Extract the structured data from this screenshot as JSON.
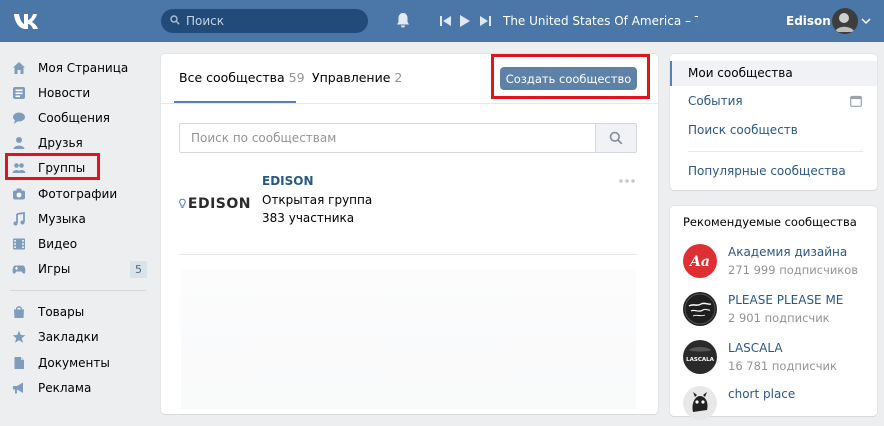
{
  "topbar": {
    "logo": "vk-logo",
    "search_placeholder": "Поиск",
    "track_title": "The United States Of America – The ...",
    "user_name": "Edison"
  },
  "nav": {
    "items": [
      {
        "label": "Моя Страница",
        "icon": "home-icon"
      },
      {
        "label": "Новости",
        "icon": "news-icon"
      },
      {
        "label": "Сообщения",
        "icon": "messages-icon"
      },
      {
        "label": "Друзья",
        "icon": "friends-icon"
      },
      {
        "label": "Группы",
        "icon": "groups-icon"
      },
      {
        "label": "Фотографии",
        "icon": "camera-icon"
      },
      {
        "label": "Музыка",
        "icon": "music-icon"
      },
      {
        "label": "Видео",
        "icon": "video-icon"
      },
      {
        "label": "Игры",
        "icon": "games-icon",
        "badge": "5"
      }
    ],
    "items2": [
      {
        "label": "Товары",
        "icon": "bag-icon"
      },
      {
        "label": "Закладки",
        "icon": "star-icon"
      },
      {
        "label": "Документы",
        "icon": "document-icon"
      },
      {
        "label": "Реклама",
        "icon": "megaphone-icon"
      }
    ]
  },
  "main": {
    "tab_all": "Все сообщества",
    "tab_all_count": "59",
    "tab_manage": "Управление",
    "tab_manage_count": "2",
    "create_label": "Создать сообщество",
    "search_placeholder": "Поиск по сообществам",
    "group": {
      "logo_text": "EDISON",
      "name": "EDISON",
      "type": "Открытая группа",
      "members": "383 участника"
    }
  },
  "right_menu": {
    "items": [
      "Мои сообщества",
      "События",
      "Поиск сообществ",
      "Популярные сообщества"
    ]
  },
  "recommended": {
    "title": "Рекомендуемые сообщества",
    "items": [
      {
        "name": "Академия дизайна",
        "sub": "271 999 подписчиков",
        "avatar_text": "Aa",
        "color": "#e02f33"
      },
      {
        "name": "PLEASE PLEASE ME",
        "sub": "2 901 подписчик",
        "avatar_text": "Please please me",
        "color": "#1e1e1e"
      },
      {
        "name": "LASCALA",
        "sub": "16 781 подписчик",
        "avatar_text": "LASCALA",
        "color": "#2a2a2a"
      },
      {
        "name": "chort place",
        "sub": "",
        "avatar_text": "",
        "color": "#e8e8e8"
      }
    ]
  },
  "colors": {
    "topbar": "#4a76a8",
    "link": "#2a5885",
    "button": "#5e81a8",
    "highlight": "#e0141c"
  }
}
